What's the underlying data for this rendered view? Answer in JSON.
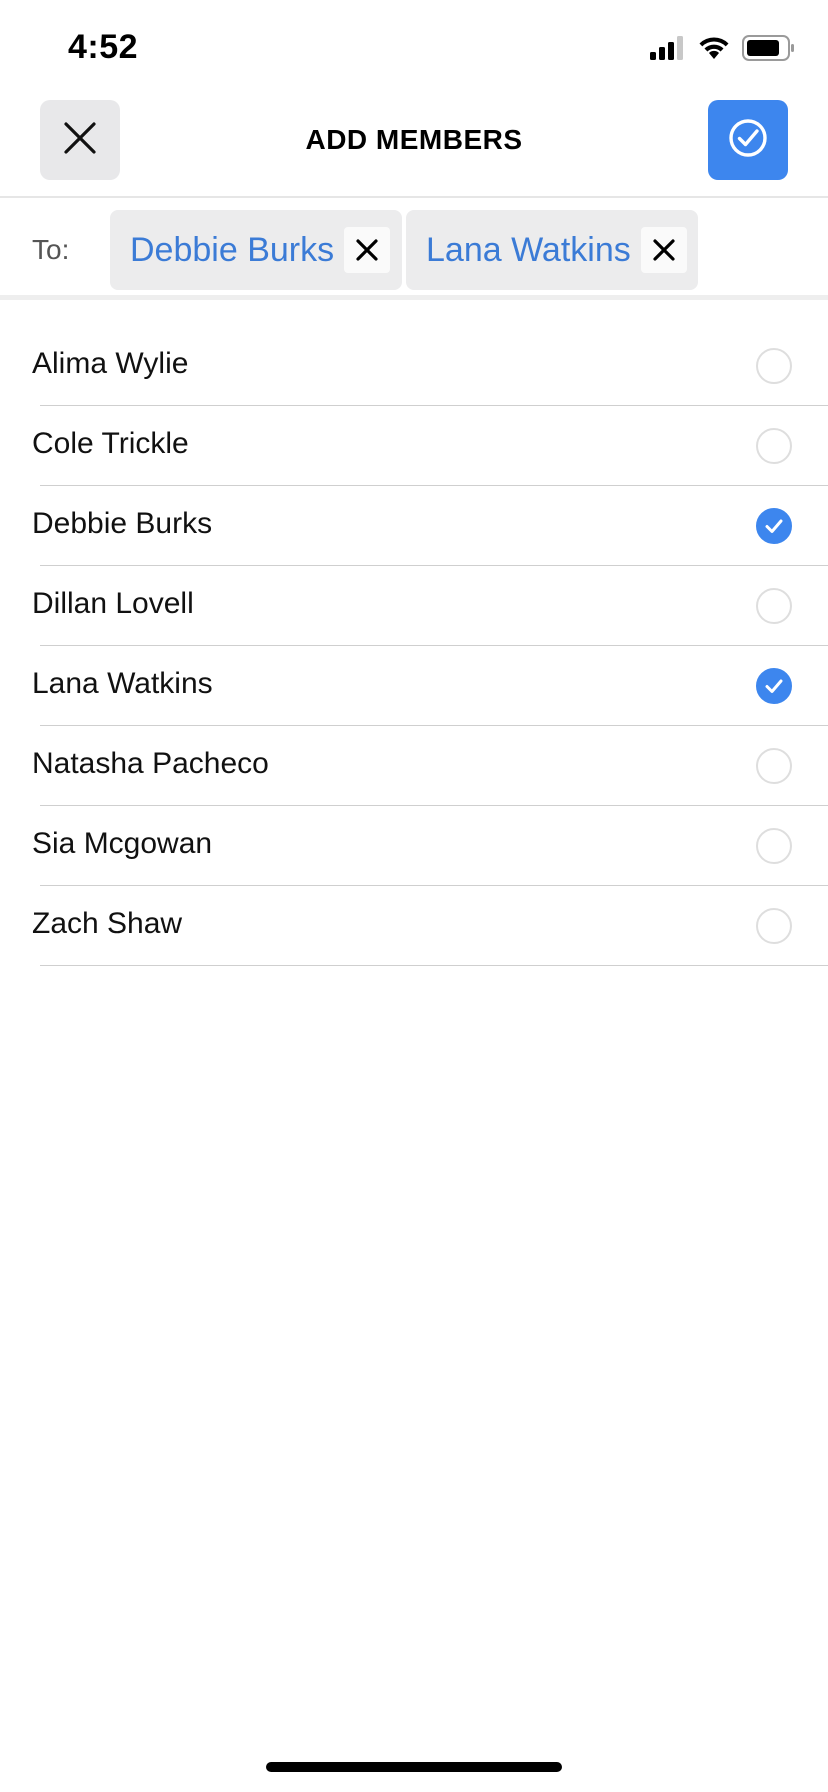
{
  "status_bar": {
    "time": "4:52",
    "icons": [
      "signal-icon",
      "wifi-icon",
      "battery-icon"
    ]
  },
  "header": {
    "title": "ADD MEMBERS",
    "close_icon": "close-icon",
    "confirm_icon": "check-circle-icon"
  },
  "recipients": {
    "label": "To:",
    "chips": [
      {
        "name": "Debbie Burks"
      },
      {
        "name": "Lana Watkins"
      }
    ]
  },
  "members": [
    {
      "name": "Alima Wylie",
      "selected": false
    },
    {
      "name": "Cole Trickle",
      "selected": false
    },
    {
      "name": "Debbie Burks",
      "selected": true
    },
    {
      "name": "Dillan Lovell",
      "selected": false
    },
    {
      "name": "Lana Watkins",
      "selected": true
    },
    {
      "name": "Natasha Pacheco",
      "selected": false
    },
    {
      "name": "Sia Mcgowan",
      "selected": false
    },
    {
      "name": "Zach Shaw",
      "selected": false
    }
  ],
  "colors": {
    "accent": "#3d86ee",
    "chip_text": "#3b7bd6"
  }
}
